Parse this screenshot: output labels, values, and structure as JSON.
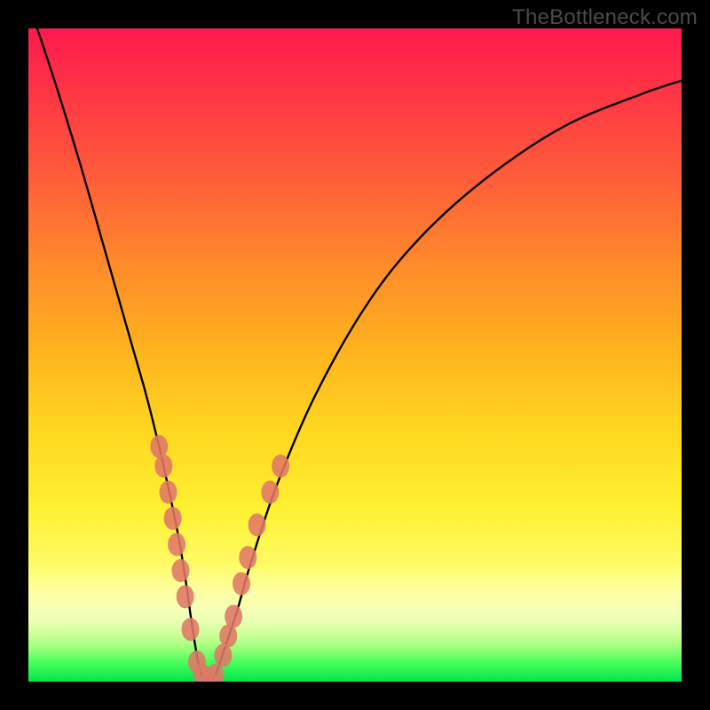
{
  "watermark": "TheBottleneck.com",
  "chart_data": {
    "type": "line",
    "title": "",
    "xlabel": "",
    "ylabel": "",
    "xlim": [
      0,
      100
    ],
    "ylim": [
      0,
      100
    ],
    "series": [
      {
        "name": "bottleneck-curve",
        "x": [
          0,
          4,
          8,
          12,
          16,
          18,
          20,
          22,
          23,
          24,
          25,
          26,
          27,
          28,
          29,
          30,
          32,
          34,
          38,
          44,
          52,
          60,
          70,
          82,
          94,
          100
        ],
        "y": [
          104,
          92,
          79,
          65,
          51,
          44,
          36,
          27,
          22,
          16,
          9,
          3,
          0,
          0,
          2,
          5,
          11,
          18,
          30,
          44,
          58,
          68,
          77,
          85,
          90,
          92
        ]
      }
    ],
    "markers": {
      "name": "highlight-beads",
      "color": "#e07766",
      "points": [
        {
          "x": 20.0,
          "y": 36
        },
        {
          "x": 20.7,
          "y": 33
        },
        {
          "x": 21.4,
          "y": 29
        },
        {
          "x": 22.1,
          "y": 25
        },
        {
          "x": 22.7,
          "y": 21
        },
        {
          "x": 23.3,
          "y": 17
        },
        {
          "x": 24.0,
          "y": 13
        },
        {
          "x": 24.8,
          "y": 8
        },
        {
          "x": 25.8,
          "y": 3
        },
        {
          "x": 26.6,
          "y": 1
        },
        {
          "x": 27.6,
          "y": 0
        },
        {
          "x": 28.6,
          "y": 1
        },
        {
          "x": 29.8,
          "y": 4
        },
        {
          "x": 30.6,
          "y": 7
        },
        {
          "x": 31.4,
          "y": 10
        },
        {
          "x": 32.6,
          "y": 15
        },
        {
          "x": 33.6,
          "y": 19
        },
        {
          "x": 35.0,
          "y": 24
        },
        {
          "x": 37.0,
          "y": 29
        },
        {
          "x": 38.6,
          "y": 33
        }
      ]
    }
  }
}
